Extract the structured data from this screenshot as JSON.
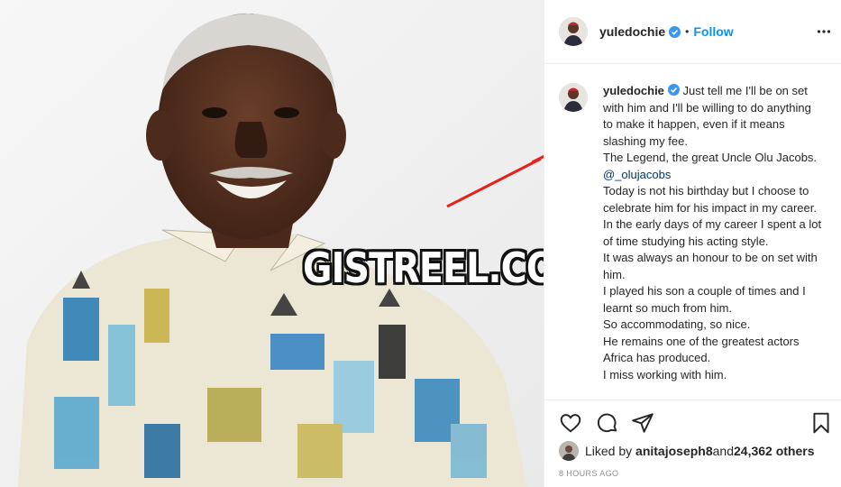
{
  "post": {
    "watermark": "GISTREEL.COM"
  },
  "header": {
    "username": "yuledochie",
    "separator": "•",
    "follow_label": "Follow",
    "more_icon": "more-options-icon"
  },
  "caption": {
    "username": "yuledochie",
    "line1": " Just tell me I'll be on set with him and I'll be willing to do anything to make it happen, even if it means slashing my fee.",
    "line2": "The Legend, the great Uncle Olu Jacobs. ",
    "mention": "@_olujacobs",
    "line3": "Today is not his birthday but I choose to celebrate him for his impact in my career.",
    "line4": "In the early days of my career I spent a lot of time studying his acting style.",
    "line5": "It was always an honour to be on set with him.",
    "line6": "I played his son a couple of times and I learnt so much from him.",
    "line7": "So accommodating, so nice.",
    "line8": "He remains one of the greatest actors Africa has produced.",
    "line9": "I miss working with him."
  },
  "actions": {
    "like_icon": "heart-icon",
    "comment_icon": "comment-icon",
    "share_icon": "share-icon",
    "save_icon": "bookmark-icon"
  },
  "likes": {
    "prefix": "Liked by ",
    "user": "anitajoseph8",
    "middle": " and ",
    "count": "24,362 others"
  },
  "timestamp": "8 HOURS AGO",
  "colors": {
    "accent": "#0095f6",
    "verified": "#3897f0",
    "arrow": "#e8201a"
  }
}
